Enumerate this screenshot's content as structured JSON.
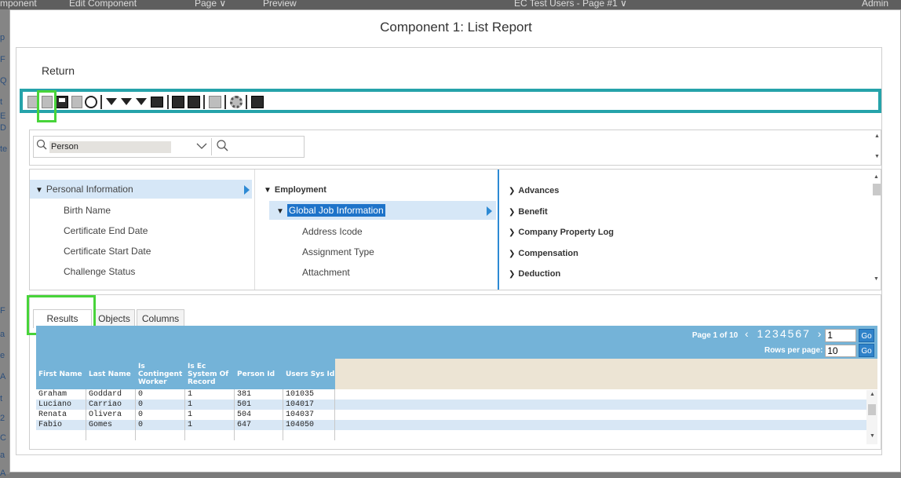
{
  "background_app": {
    "top_items": [
      "mponent",
      "Edit Component",
      "Page ∨",
      "Preview",
      "EC Test Users - Page #1 ∨",
      "Admin"
    ],
    "left_letters": [
      "p",
      "F",
      "Q",
      "t",
      "E",
      "D",
      "te",
      "F",
      "a",
      "e",
      "A",
      "t",
      "2",
      "C",
      "a",
      "A"
    ]
  },
  "modal": {
    "title": "Component 1: List Report",
    "return_label": "Return"
  },
  "toolbar": {
    "icons": [
      "new-doc-icon",
      "open-doc-icon",
      "save-icon",
      "copy-icon",
      "cancel-icon",
      "filter-icon",
      "filter-edit-icon",
      "filter-clear-icon",
      "grid-icon",
      "sort-az-icon",
      "formula-icon",
      "export-icon",
      "settings-icon",
      "chart-icon"
    ]
  },
  "search": {
    "object_value": "Person",
    "query_value": ""
  },
  "tree": {
    "left": {
      "selected": "Personal Information",
      "items": [
        "Birth Name",
        "Certificate End Date",
        "Certificate Start Date",
        "Challenge Status"
      ]
    },
    "middle": {
      "header": "Employment",
      "selected": "Global Job Information",
      "items": [
        "Address Icode",
        "Assignment Type",
        "Attachment"
      ]
    },
    "right": {
      "items": [
        "Advances",
        "Benefit",
        "Company Property Log",
        "Compensation",
        "Deduction"
      ]
    }
  },
  "tabs": [
    "Results",
    "Objects",
    "Columns"
  ],
  "pager": {
    "page_label": "Page 1 of 10",
    "prev": "‹",
    "next": "›",
    "pages": "1234567",
    "page_input": "1",
    "go": "Go",
    "rows_label": "Rows per page:",
    "rows_value": "10",
    "rows_go": "Go"
  },
  "table": {
    "columns": [
      "First Name",
      "Last Name",
      "Is Contingent Worker",
      "Is Ec System Of Record",
      "Person Id",
      "Users Sys Id"
    ],
    "rows": [
      [
        "Graham",
        "Goddard",
        "0",
        "1",
        "381",
        "101035"
      ],
      [
        "Luciano",
        "Carriao",
        "0",
        "1",
        "501",
        "104017"
      ],
      [
        "Renata",
        "Olivera",
        "0",
        "1",
        "504",
        "104037"
      ],
      [
        "Fabio",
        "Gomes",
        "0",
        "1",
        "647",
        "104050"
      ]
    ]
  },
  "colors": {
    "toolbar_border": "#26a3aa",
    "highlight": "#48d43a",
    "grid_header": "#74b3d8",
    "selection": "#1e73c9"
  }
}
